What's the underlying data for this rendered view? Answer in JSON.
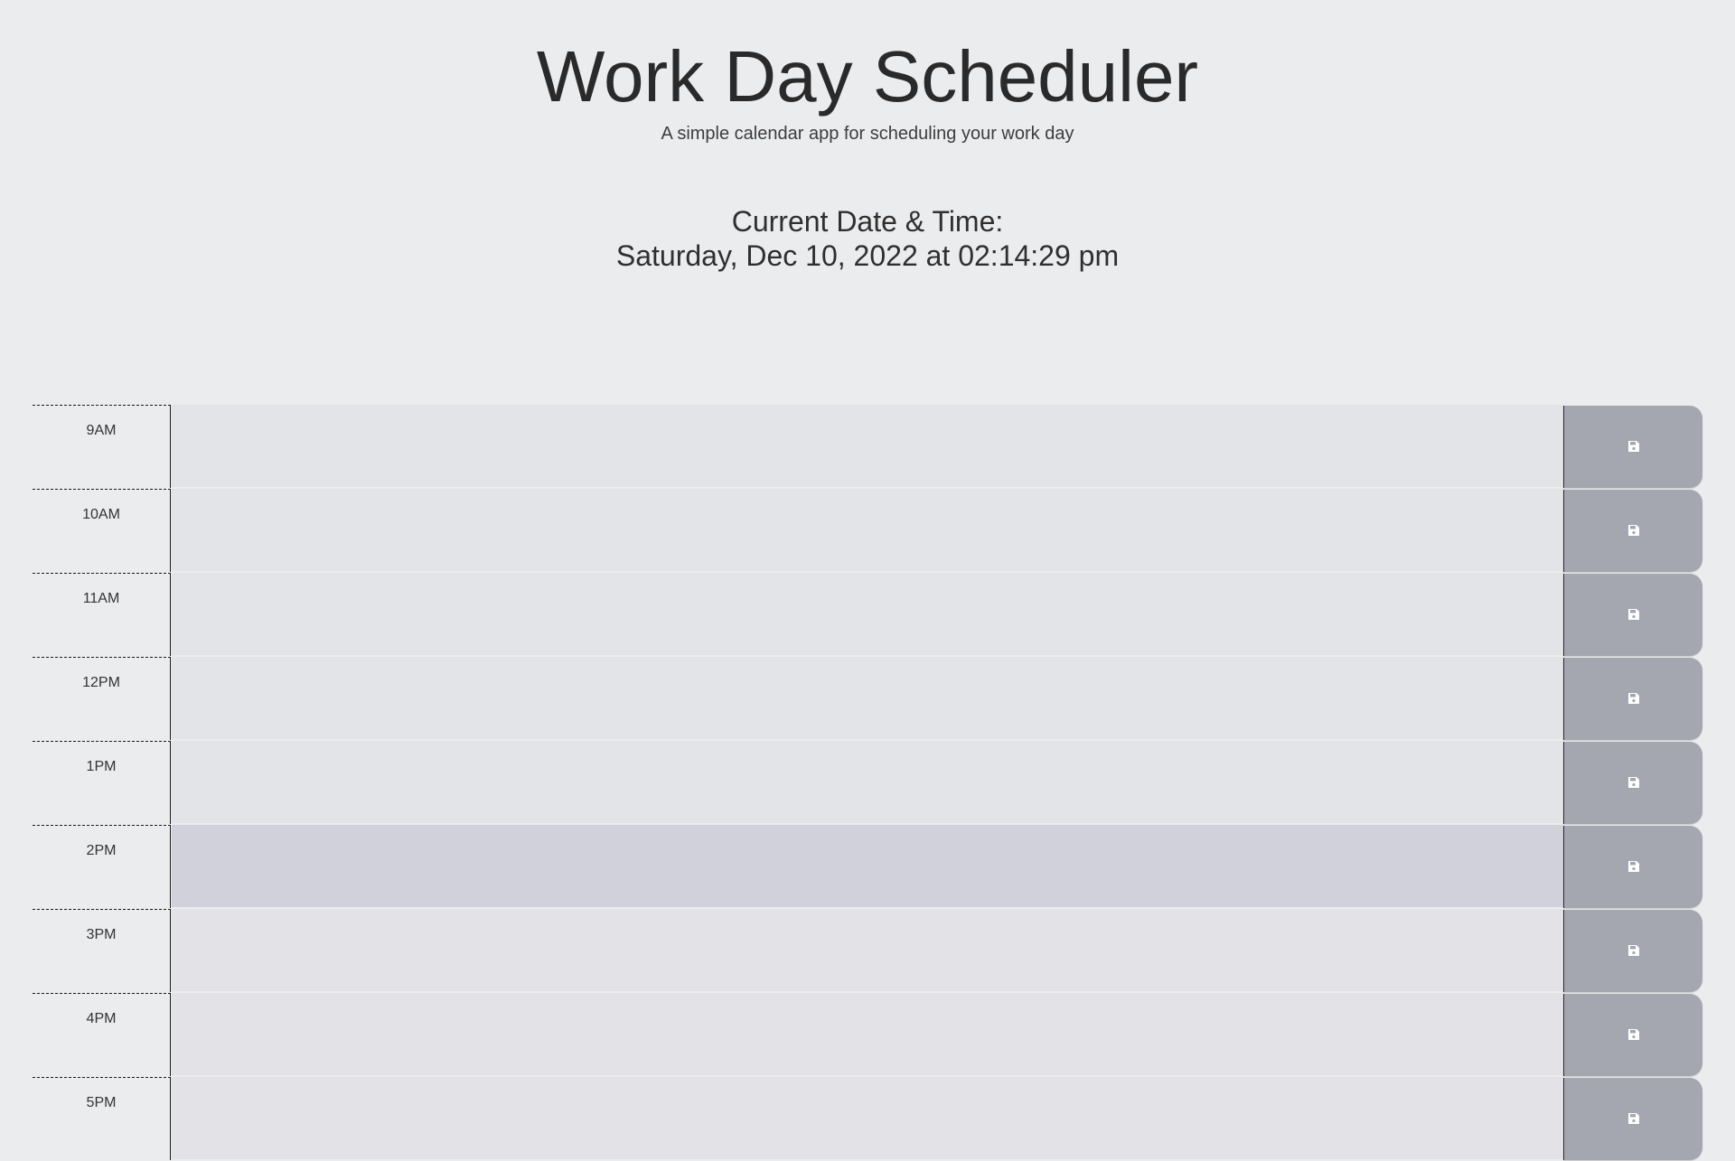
{
  "header": {
    "title": "Work Day Scheduler",
    "subtitle": "A simple calendar app for scheduling your work day"
  },
  "current_datetime": {
    "heading": "Current Date & Time:",
    "value": "Saturday, Dec 10, 2022 at 02:14:29 pm"
  },
  "colors": {
    "page_background": "#ebecee",
    "past_block": "#e3e4e7",
    "present_block": "#d0d1db",
    "future_block": "#e3e2e7",
    "save_button": "#a4a6b0",
    "save_icon": "#ffffff"
  },
  "save_icon_name": "floppy-disk-icon",
  "schedule": {
    "hours": [
      {
        "label": "9AM",
        "state": "past",
        "text": ""
      },
      {
        "label": "10AM",
        "state": "past",
        "text": ""
      },
      {
        "label": "11AM",
        "state": "past",
        "text": ""
      },
      {
        "label": "12PM",
        "state": "past",
        "text": ""
      },
      {
        "label": "1PM",
        "state": "past",
        "text": ""
      },
      {
        "label": "2PM",
        "state": "present",
        "text": ""
      },
      {
        "label": "3PM",
        "state": "future",
        "text": ""
      },
      {
        "label": "4PM",
        "state": "future",
        "text": ""
      },
      {
        "label": "5PM",
        "state": "future",
        "text": ""
      }
    ]
  }
}
